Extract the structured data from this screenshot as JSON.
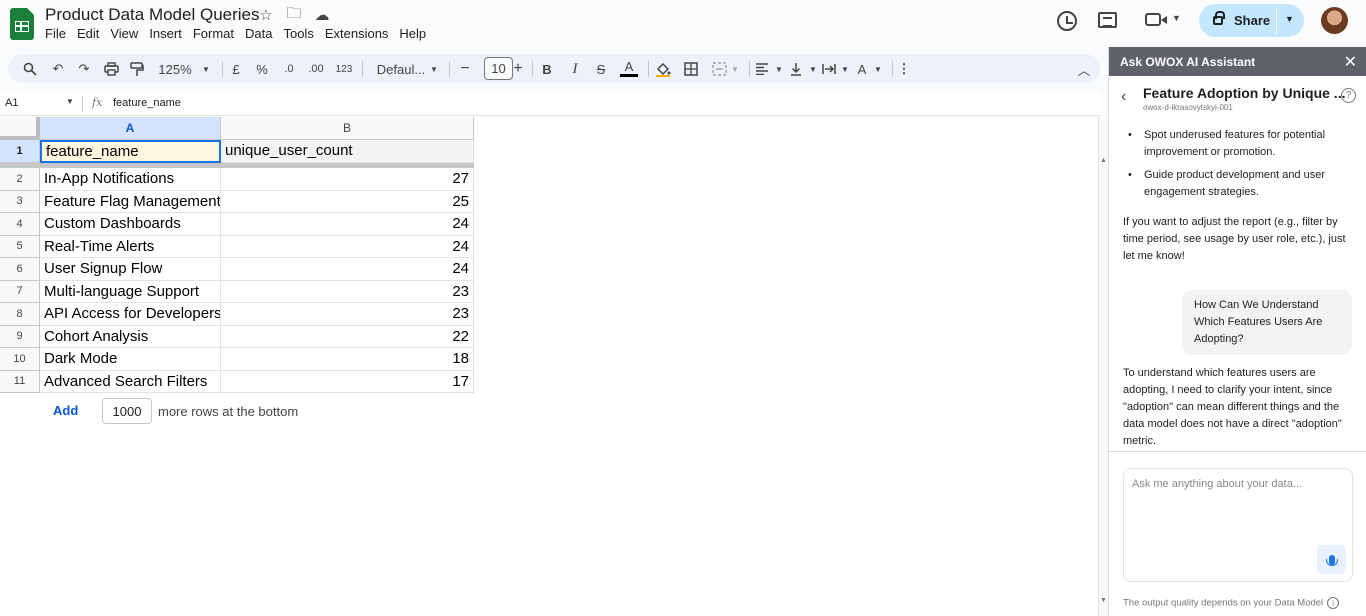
{
  "app": {
    "doc_title": "Product Data Model Queries",
    "menu": [
      "File",
      "Edit",
      "View",
      "Insert",
      "Format",
      "Data",
      "Tools",
      "Extensions",
      "Help"
    ],
    "share_label": "Share"
  },
  "toolbar": {
    "zoom": "125%",
    "currency": "£",
    "percent": "%",
    "decimal_decrease": ".0",
    "decimal_increase": ".00",
    "number_format": "123",
    "font": "Defaul...",
    "font_size": "10",
    "bold": "B",
    "italic": "I",
    "strike": "S",
    "text_color": "A",
    "rotate": "A",
    "more": "⋮"
  },
  "formula_bar": {
    "cell_ref": "A1",
    "fx": "fx",
    "content": "feature_name"
  },
  "sheet": {
    "columns": [
      "A",
      "B"
    ],
    "rows": [
      {
        "num": "1",
        "a": "feature_name",
        "b": "unique_user_count"
      },
      {
        "num": "2",
        "a": "In-App Notifications",
        "b": "27"
      },
      {
        "num": "3",
        "a": "Feature Flag Management",
        "b": "25"
      },
      {
        "num": "4",
        "a": "Custom Dashboards",
        "b": "24"
      },
      {
        "num": "5",
        "a": "Real-Time Alerts",
        "b": "24"
      },
      {
        "num": "6",
        "a": "User Signup Flow",
        "b": "24"
      },
      {
        "num": "7",
        "a": "Multi-language Support",
        "b": "23"
      },
      {
        "num": "8",
        "a": "API Access for Developers",
        "b": "23"
      },
      {
        "num": "9",
        "a": "Cohort Analysis",
        "b": "22"
      },
      {
        "num": "10",
        "a": "Dark Mode",
        "b": "18"
      },
      {
        "num": "11",
        "a": "Advanced Search Filters",
        "b": "17"
      }
    ],
    "add_label": "Add",
    "add_count": "1000",
    "add_tail": "more rows at the bottom"
  },
  "panel": {
    "header": "Ask OWOX AI Assistant",
    "title": "Feature Adoption by Unique ...",
    "subtitle": "owox-d-ikrasovytskyi-001",
    "bullets": [
      "Spot underused features for potential improvement or promotion.",
      "Guide product development and user engagement strategies."
    ],
    "para1": "If you want to adjust the report (e.g., filter by time period, see usage by user role, etc.), just let me know!",
    "user_message": "How Can We Understand Which Features Users Are Adopting?",
    "para2": "To understand which features users are adopting, I need to clarify your intent, since \"adoption\" can mean different things and the data model does not have a direct \"adoption\" metric.",
    "input_placeholder": "Ask me anything about your data...",
    "footer": "The output quality depends on your Data Model"
  },
  "colors": {
    "brand_green": "#188038",
    "share_bg": "#c2e7ff",
    "selection_blue": "#1a73e8",
    "panel_header": "#5f6368"
  }
}
